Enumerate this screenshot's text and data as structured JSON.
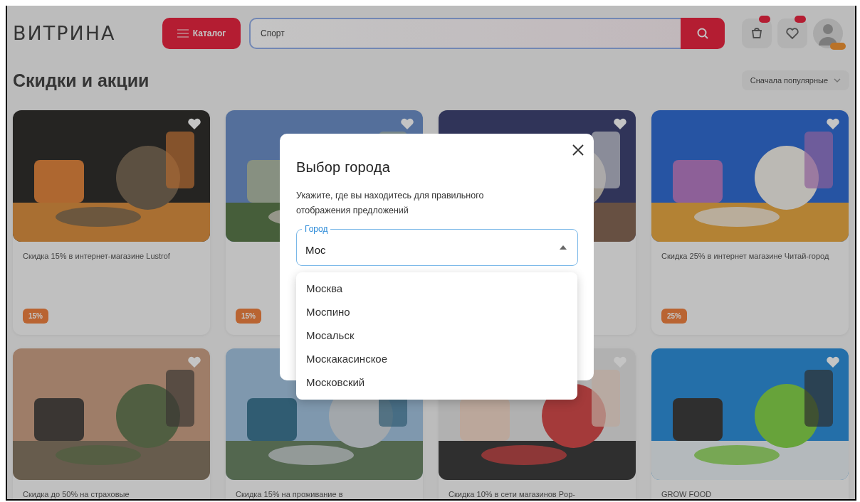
{
  "header": {
    "logo": "ВИТРИНА",
    "catalog_button": "Каталог",
    "search": {
      "value": "Спорт"
    }
  },
  "section": {
    "title": "Скидки и акции",
    "sort": "Сначала популярные"
  },
  "cards": [
    {
      "image": {
        "kind": "picture"
      },
      "description": "Скидка 15% в интернет-магазине Lustrof",
      "badge": "15%"
    },
    {
      "image": {
        "kind": "picture"
      },
      "badge": "15%"
    },
    {
      "image": {
        "kind": "picture"
      }
    },
    {
      "image": {
        "kind": "picture"
      },
      "description": "Скидка 25% в интернет магазине Читай-город",
      "badge": "25%"
    },
    {
      "image": {
        "kind": "picture"
      },
      "description": "Скидка до 50% на страховые"
    },
    {
      "image": {
        "kind": "picture"
      },
      "description": "Скидка 15% на проживание в"
    },
    {
      "image": {
        "kind": "picture"
      },
      "description": "Скидка 10% в сети магазинов Pop-"
    },
    {
      "image": {
        "kind": "picture"
      },
      "description": "GROW FOOD"
    }
  ],
  "dialog": {
    "title": "Выбор города",
    "text": "Укажите, где вы находитесь для правильного отображения предложений",
    "field": {
      "label": "Город",
      "value": "Мос",
      "expanded": true
    },
    "options": [
      "Москва",
      "Моспино",
      "Мосальск",
      "Москакасинское",
      "Московский"
    ]
  }
}
